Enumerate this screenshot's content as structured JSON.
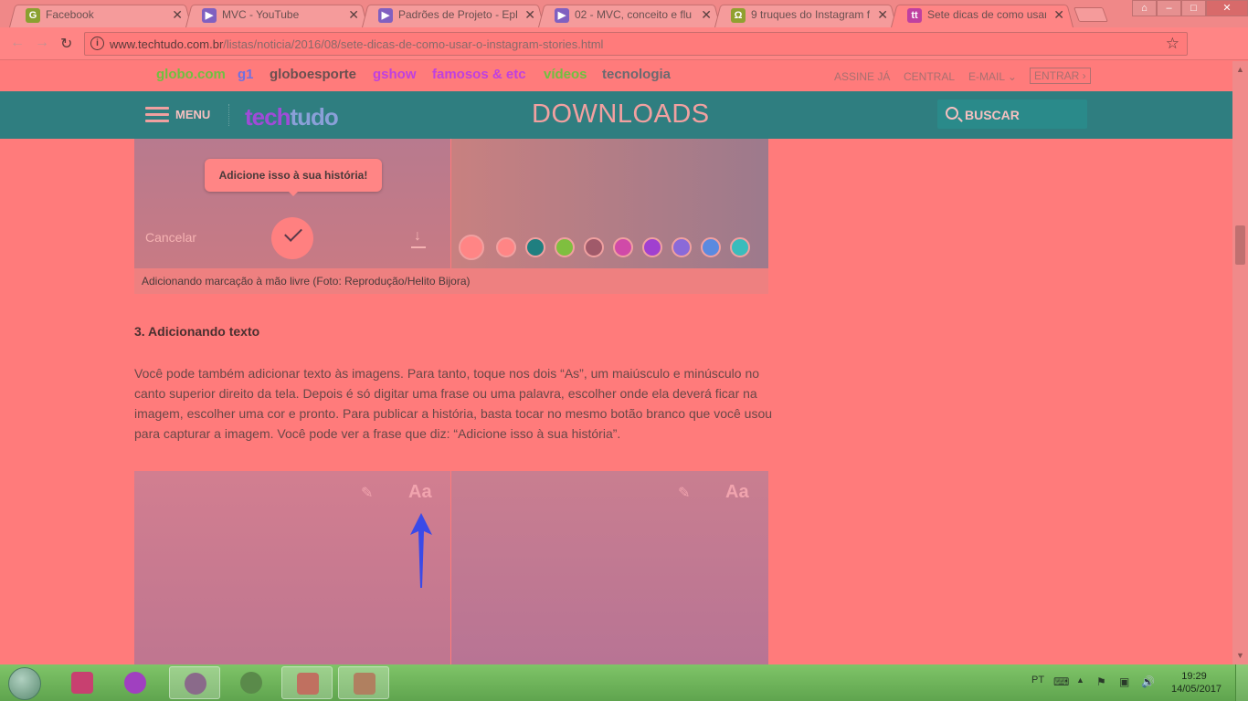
{
  "browser": {
    "tabs": [
      {
        "title": "Facebook",
        "icon_color": "#8aa030",
        "active": false
      },
      {
        "title": "MVC - YouTube",
        "icon_color": "#8060c0",
        "active": false
      },
      {
        "title": "Padrões de Projeto - Epl",
        "icon_color": "#8060c0",
        "active": false
      },
      {
        "title": "02 - MVC, conceito e flu",
        "icon_color": "#8060c0",
        "active": false
      },
      {
        "title": "9 truques do Instagram f",
        "icon_color": "#90a030",
        "active": false
      },
      {
        "title": "Sete dicas de como usar",
        "icon_color": "#c040a0",
        "active": true
      }
    ],
    "url_domain": "www.techtudo.com.br",
    "url_path": "/listas/noticia/2016/08/sete-dicas-de-como-usar-o-instagram-stories.html"
  },
  "globo": {
    "links": [
      {
        "label": "globo.com",
        "color": "#70c040"
      },
      {
        "label": "g1",
        "color": "#7070e0"
      },
      {
        "label": "globoesporte",
        "color": "#6a5050"
      },
      {
        "label": "gshow",
        "color": "#c040e0"
      },
      {
        "label": "famosos & etc",
        "color": "#c040e0"
      },
      {
        "label": "vídeos",
        "color": "#70c040"
      },
      {
        "label": "tecnologia",
        "color": "#6a6a70"
      }
    ],
    "right": {
      "subscribe": "ASSINE JÁ",
      "central": "CENTRAL",
      "email": "E-MAIL",
      "enter": "ENTRAR ›"
    }
  },
  "header": {
    "menu": "MENU",
    "logo_a": "tech",
    "logo_b": "tudo",
    "section": "DOWNLOADS",
    "search": "BUSCAR"
  },
  "figure1": {
    "tooltip": "Adicione isso à sua história!",
    "cancel": "Cancelar",
    "swatches": [
      "#ff8585",
      "#ff8585",
      "#1f7f80",
      "#7fbf3f",
      "#a05a6a",
      "#d04aa8",
      "#a040d0",
      "#8a6ad8",
      "#5a8ae0",
      "#3abcbc"
    ],
    "caption": "Adicionando marcação à mão livre (Foto: Reprodução/Helito Bijora)"
  },
  "article": {
    "heading": "3. Adicionando texto",
    "paragraph": "Você pode também adicionar texto às imagens. Para tanto, toque nos dois “As”, um maiúsculo e minúsculo no canto superior direito da tela. Depois é só digitar uma frase ou uma palavra, escolher onde ela deverá ficar na imagem, escolher uma cor e pronto. Para publicar a história, basta tocar no mesmo botão branco que você usou para capturar a imagem. Você pode ver a frase que diz: “Adicione isso à sua história”."
  },
  "figure2": {
    "text_tool": "Aa",
    "arrow_color": "#3a4ae8"
  },
  "taskbar": {
    "lang": "PT",
    "time": "19:29",
    "date": "14/05/2017",
    "apps": [
      {
        "name": "file-explorer",
        "color": "#c84070"
      },
      {
        "name": "media-player",
        "color": "#a040c0"
      },
      {
        "name": "chrome",
        "color": "#8a6a8a"
      },
      {
        "name": "internet-explorer",
        "color": "#5a8a4a"
      },
      {
        "name": "paint",
        "color": "#c07060"
      },
      {
        "name": "image-viewer",
        "color": "#b08060"
      }
    ]
  }
}
